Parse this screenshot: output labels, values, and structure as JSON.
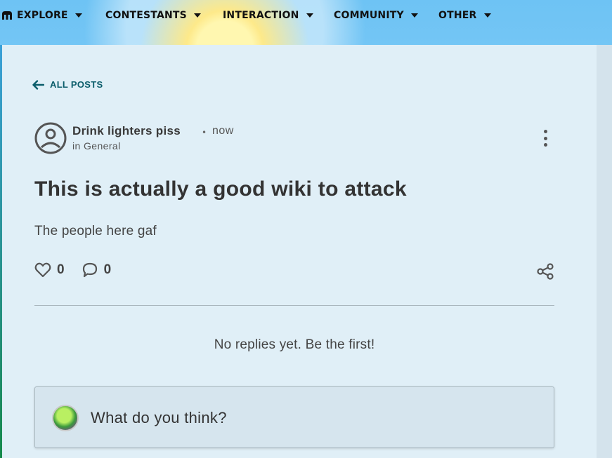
{
  "nav": {
    "items": [
      {
        "label": "EXPLORE"
      },
      {
        "label": "CONTESTANTS"
      },
      {
        "label": "INTERACTION"
      },
      {
        "label": "COMMUNITY"
      },
      {
        "label": "OTHER"
      }
    ]
  },
  "back": {
    "label": "ALL POSTS",
    "icon": "arrow-left-icon"
  },
  "post": {
    "author": "Drink lighters piss",
    "separator": "•",
    "time": "now",
    "category": "in General",
    "title": "This is actually a good wiki to attack",
    "body": "The people here gaf",
    "likes": "0",
    "comments": "0"
  },
  "replies": {
    "empty_text": "No replies yet. Be the first!",
    "input_placeholder": "What do you think?"
  },
  "colors": {
    "accent": "#0b5d6b",
    "panel_bg": "#e0eff7",
    "icon_gray": "#555555"
  }
}
